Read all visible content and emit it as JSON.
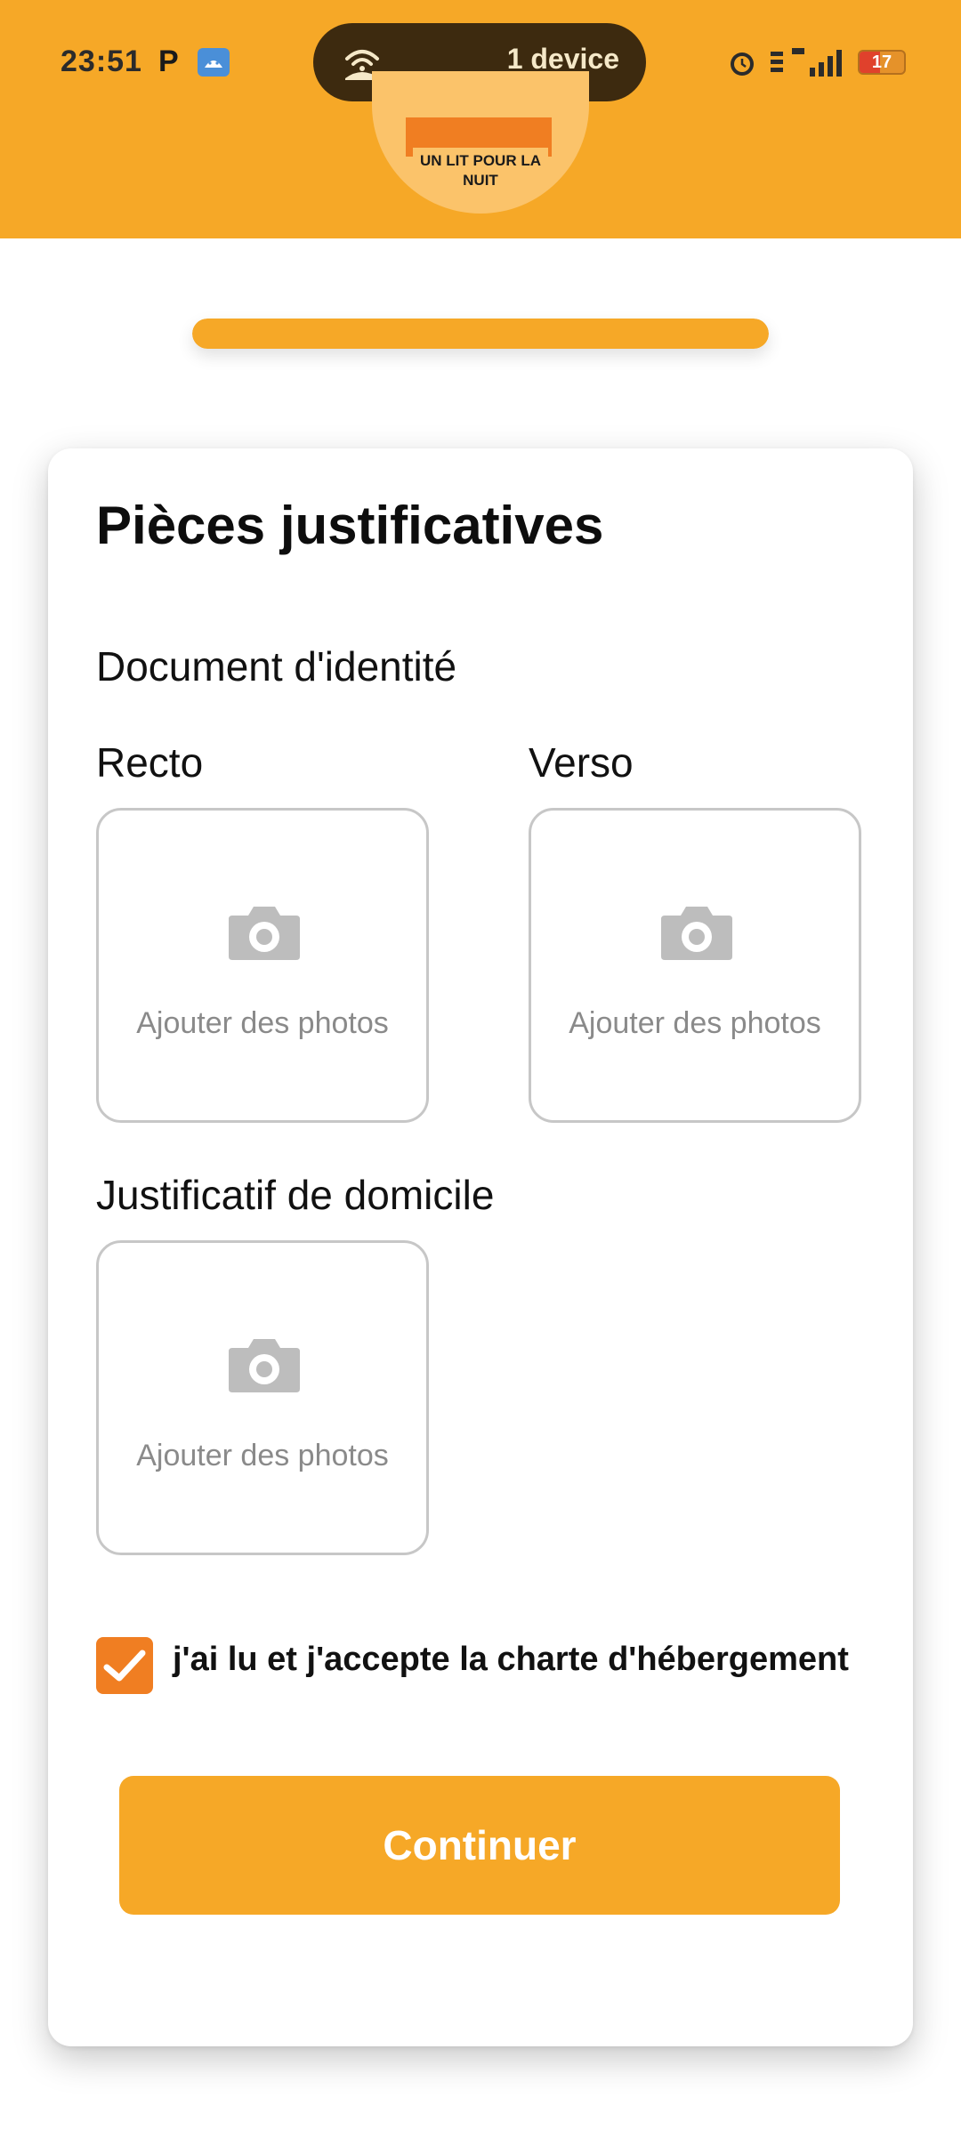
{
  "status_bar": {
    "time": "23:51",
    "notification_letter": "P",
    "pill_text": "1 device",
    "battery": "17"
  },
  "logo": {
    "text": "UN LIT POUR LA NUIT"
  },
  "progress": {
    "value": 1.0
  },
  "form": {
    "title": "Pièces justificatives",
    "identity_section": "Document d'identité",
    "recto_label": "Recto",
    "verso_label": "Verso",
    "address_section": "Justificatif de domicile",
    "upload_label": "Ajouter des photos",
    "charter_checkbox": {
      "checked": true,
      "label": "j'ai lu et j'accepte la charte d'hébergement"
    },
    "continue_button": "Continuer"
  },
  "colors": {
    "brand": "#F6A827",
    "checkbox": "#F07E22",
    "placeholder": "#8a8a8a"
  },
  "icons": [
    "camera-icon",
    "wifi-icon",
    "alarm-icon",
    "signal-icon",
    "battery-icon",
    "checkmark-icon"
  ]
}
